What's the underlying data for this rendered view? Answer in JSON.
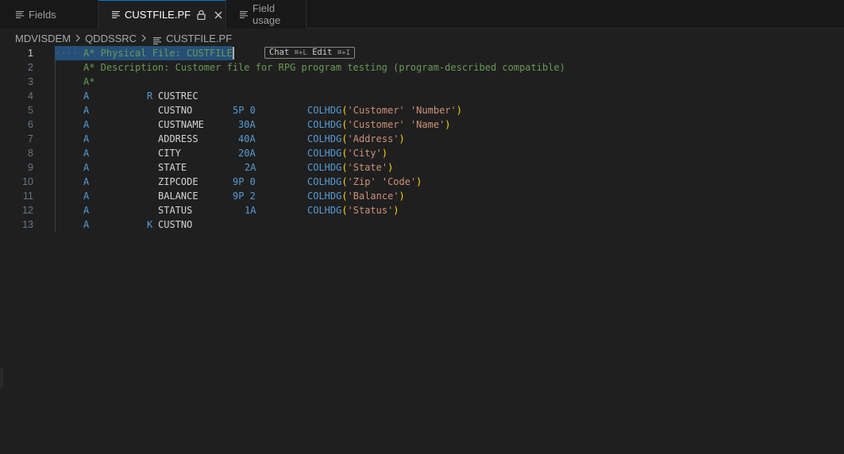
{
  "tabs": [
    {
      "label": "Fields"
    },
    {
      "label": "CUSTFILE.PF"
    },
    {
      "label": "Field usage"
    }
  ],
  "breadcrumb": [
    "MDVISDEM",
    "QDDSSRC",
    "CUSTFILE.PF"
  ],
  "inline_hint": {
    "chat": "Chat",
    "chat_keys": "⌘+L",
    "edit": "Edit",
    "edit_keys": "⌘+I"
  },
  "editor": {
    "line_numbers": [
      "1",
      "2",
      "3",
      "4",
      "5",
      "6",
      "7",
      "8",
      "9",
      "10",
      "11",
      "12",
      "13"
    ],
    "lines": [
      {
        "comment": "A* Physical File: CUSTFILE"
      },
      {
        "comment": "A* Description: Customer file for RPG program testing (program-described compatible)"
      },
      {
        "comment": "A*"
      },
      {
        "a": "A",
        "type": "R",
        "name": "CUSTREC"
      },
      {
        "a": "A",
        "name": "CUSTNO",
        "len": "5P 0",
        "fn": "COLHDG",
        "args": [
          "'Customer'",
          "'Number'"
        ]
      },
      {
        "a": "A",
        "name": "CUSTNAME",
        "len": "30A",
        "fn": "COLHDG",
        "args": [
          "'Customer'",
          "'Name'"
        ]
      },
      {
        "a": "A",
        "name": "ADDRESS",
        "len": "40A",
        "fn": "COLHDG",
        "args": [
          "'Address'"
        ]
      },
      {
        "a": "A",
        "name": "CITY",
        "len": "20A",
        "fn": "COLHDG",
        "args": [
          "'City'"
        ]
      },
      {
        "a": "A",
        "name": "STATE",
        "len": "2A",
        "fn": "COLHDG",
        "args": [
          "'State'"
        ]
      },
      {
        "a": "A",
        "name": "ZIPCODE",
        "len": "9P 0",
        "fn": "COLHDG",
        "args": [
          "'Zip'",
          "'Code'"
        ]
      },
      {
        "a": "A",
        "name": "BALANCE",
        "len": "9P 2",
        "fn": "COLHDG",
        "args": [
          "'Balance'"
        ]
      },
      {
        "a": "A",
        "name": "STATUS",
        "len": "1A",
        "fn": "COLHDG",
        "args": [
          "'Status'"
        ]
      },
      {
        "a": "A",
        "type": "K",
        "name": "CUSTNO"
      }
    ]
  },
  "colors": {
    "accent": "#0078d4",
    "selection": "#264f78",
    "comment": "#6a9955",
    "keyword": "#569cd6",
    "string": "#ce9178",
    "paren": "#ffd700"
  }
}
